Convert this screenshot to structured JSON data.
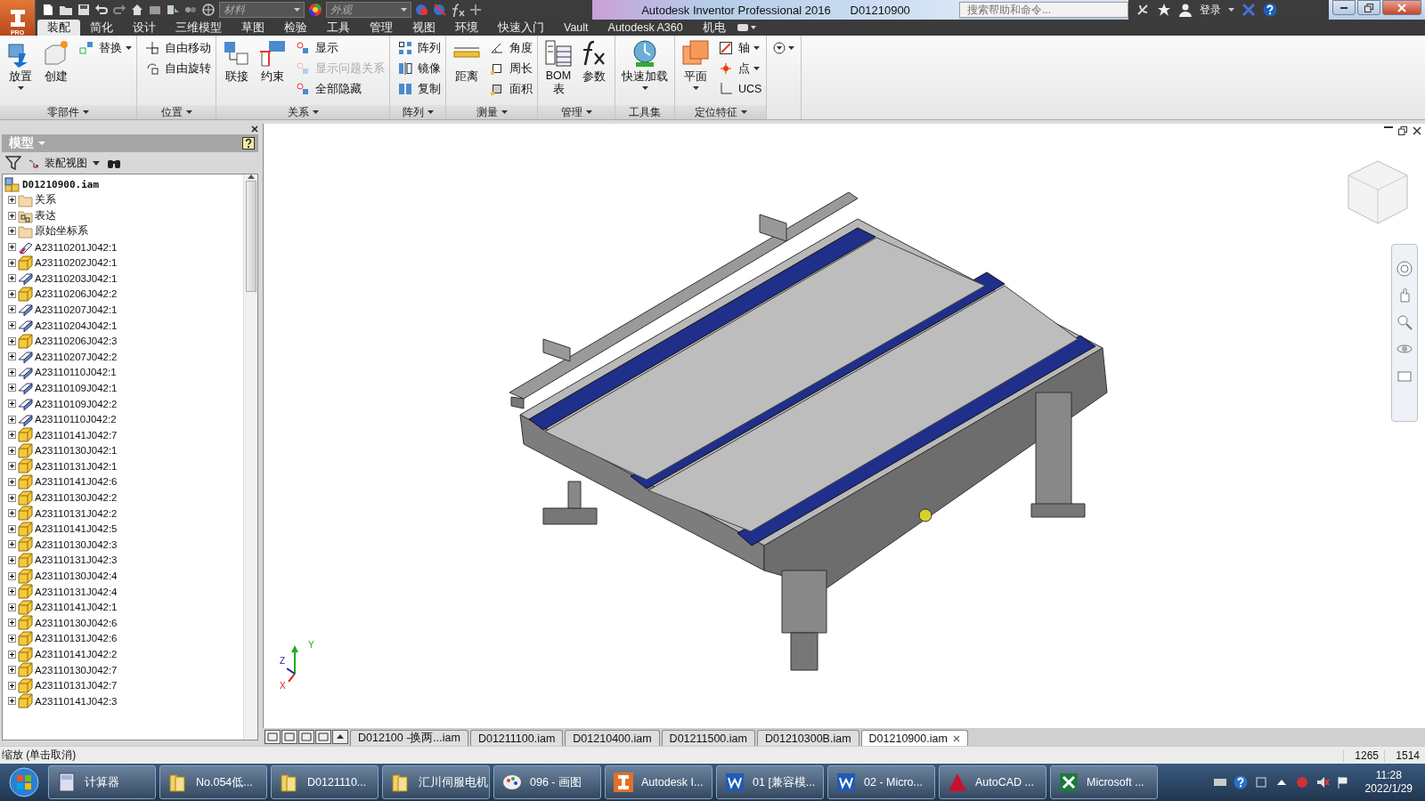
{
  "window": {
    "title": "Autodesk Inventor Professional 2016",
    "document": "D01210900"
  },
  "quick_access": {
    "material": "材料",
    "appearance": "外观"
  },
  "help_search": {
    "placeholder": "搜索帮助和命令..."
  },
  "sign_in": "登录",
  "app_badge": "PRO",
  "ribbon_tabs": [
    {
      "label": "装配",
      "selected": true
    },
    {
      "label": "简化",
      "selected": false
    },
    {
      "label": "设计",
      "selected": false
    },
    {
      "label": "三维模型",
      "selected": false
    },
    {
      "label": "草图",
      "selected": false
    },
    {
      "label": "检验",
      "selected": false
    },
    {
      "label": "工具",
      "selected": false
    },
    {
      "label": "管理",
      "selected": false
    },
    {
      "label": "视图",
      "selected": false
    },
    {
      "label": "环境",
      "selected": false
    },
    {
      "label": "快速入门",
      "selected": false
    },
    {
      "label": "Vault",
      "selected": false
    },
    {
      "label": "Autodesk A360",
      "selected": false
    },
    {
      "label": "机电",
      "selected": false
    }
  ],
  "ribbon_panels": [
    {
      "label": "零部件",
      "large": [
        {
          "label": "放置",
          "dropdown": true
        },
        {
          "label": "创建",
          "dropdown": false
        }
      ],
      "small": [
        {
          "label": "替换",
          "disabled": false,
          "dropdown": true
        }
      ]
    },
    {
      "label": "位置",
      "small": [
        {
          "label": "自由移动",
          "disabled": false,
          "dropdown": false
        },
        {
          "label": "自由旋转",
          "disabled": false,
          "dropdown": false
        }
      ]
    },
    {
      "label": "关系",
      "large": [
        {
          "label": "联接",
          "dropdown": false
        },
        {
          "label": "约束",
          "dropdown": false
        }
      ],
      "small": [
        {
          "label": "显示",
          "disabled": false,
          "dropdown": false
        },
        {
          "label": "显示问题关系",
          "disabled": true,
          "dropdown": false
        },
        {
          "label": "全部隐藏",
          "disabled": false,
          "dropdown": false
        }
      ]
    },
    {
      "label": "阵列",
      "small": [
        {
          "label": "阵列",
          "disabled": false,
          "dropdown": false
        },
        {
          "label": "镜像",
          "disabled": false,
          "dropdown": false
        },
        {
          "label": "复制",
          "disabled": false,
          "dropdown": false
        }
      ]
    },
    {
      "label": "测量",
      "large": [
        {
          "label": "距离",
          "dropdown": false
        }
      ],
      "small": [
        {
          "label": "角度",
          "disabled": false,
          "dropdown": false
        },
        {
          "label": "周长",
          "disabled": false,
          "dropdown": false
        },
        {
          "label": "面积",
          "disabled": false,
          "dropdown": false
        }
      ]
    },
    {
      "label": "管理",
      "large": [
        {
          "label": "BOM 表",
          "dropdown": false
        },
        {
          "label": "参数",
          "dropdown": false
        }
      ]
    },
    {
      "label": "工具集",
      "large": [
        {
          "label": "快速加载",
          "dropdown": true
        }
      ]
    },
    {
      "label": "定位特征",
      "large": [
        {
          "label": "平面",
          "dropdown": true
        }
      ],
      "small": [
        {
          "label": "轴",
          "disabled": false,
          "dropdown": true
        },
        {
          "label": "点",
          "disabled": false,
          "dropdown": true
        },
        {
          "label": "UCS",
          "disabled": false,
          "dropdown": false
        }
      ]
    }
  ],
  "browser": {
    "title": "模型",
    "view": "装配视图",
    "root": "D01210900.iam",
    "items": [
      {
        "kind": "folder",
        "label": "关系"
      },
      {
        "kind": "views",
        "label": "表达"
      },
      {
        "kind": "folder",
        "label": "原始坐标系"
      },
      {
        "kind": "weld",
        "label": "A23110201J042:1"
      },
      {
        "kind": "part",
        "label": "A23110202J042:1"
      },
      {
        "kind": "sheet",
        "label": "A23110203J042:1"
      },
      {
        "kind": "part",
        "label": "A23110206J042:2"
      },
      {
        "kind": "sheet",
        "label": "A23110207J042:1"
      },
      {
        "kind": "sheet",
        "label": "A23110204J042:1"
      },
      {
        "kind": "part",
        "label": "A23110206J042:3"
      },
      {
        "kind": "sheet",
        "label": "A23110207J042:2"
      },
      {
        "kind": "sheet",
        "label": "A23110110J042:1"
      },
      {
        "kind": "sheet",
        "label": "A23110109J042:1"
      },
      {
        "kind": "sheet",
        "label": "A23110109J042:2"
      },
      {
        "kind": "sheet",
        "label": "A23110110J042:2"
      },
      {
        "kind": "part",
        "label": "A23110141J042:7"
      },
      {
        "kind": "part",
        "label": "A23110130J042:1"
      },
      {
        "kind": "part",
        "label": "A23110131J042:1"
      },
      {
        "kind": "part",
        "label": "A23110141J042:6"
      },
      {
        "kind": "part",
        "label": "A23110130J042:2"
      },
      {
        "kind": "part",
        "label": "A23110131J042:2"
      },
      {
        "kind": "part",
        "label": "A23110141J042:5"
      },
      {
        "kind": "part",
        "label": "A23110130J042:3"
      },
      {
        "kind": "part",
        "label": "A23110131J042:3"
      },
      {
        "kind": "part",
        "label": "A23110130J042:4"
      },
      {
        "kind": "part",
        "label": "A23110131J042:4"
      },
      {
        "kind": "part",
        "label": "A23110141J042:1"
      },
      {
        "kind": "part",
        "label": "A23110130J042:6"
      },
      {
        "kind": "part",
        "label": "A23110131J042:6"
      },
      {
        "kind": "part",
        "label": "A23110141J042:2"
      },
      {
        "kind": "part",
        "label": "A23110130J042:7"
      },
      {
        "kind": "part",
        "label": "A23110131J042:7"
      },
      {
        "kind": "part",
        "label": "A23110141J042:3"
      }
    ]
  },
  "axis_triad": {
    "y": "Y",
    "z": "Z",
    "x": "X"
  },
  "document_tabs": [
    {
      "label": "D012100 -换两...iam",
      "selected": false
    },
    {
      "label": "D01211100.iam",
      "selected": false
    },
    {
      "label": "D01210400.iam",
      "selected": false
    },
    {
      "label": "D01211500.iam",
      "selected": false
    },
    {
      "label": "D01210300B.iam",
      "selected": false
    },
    {
      "label": "D01210900.iam",
      "selected": true
    }
  ],
  "status_bar": {
    "message": "缩放 (单击取消)",
    "values": [
      "1265",
      "1514"
    ]
  },
  "taskbar": {
    "items": [
      {
        "kind": "calc",
        "label": "计算器"
      },
      {
        "kind": "folder",
        "label": "No.054低..."
      },
      {
        "kind": "folder",
        "label": "D0121110..."
      },
      {
        "kind": "folder",
        "label": "汇川伺服电机"
      },
      {
        "kind": "paint",
        "label": "096 - 画图"
      },
      {
        "kind": "inventor",
        "label": "Autodesk I..."
      },
      {
        "kind": "word",
        "label": "01 [兼容模..."
      },
      {
        "kind": "word",
        "label": "02 - Micro..."
      },
      {
        "kind": "autocad",
        "label": "AutoCAD ..."
      },
      {
        "kind": "excel",
        "label": "Microsoft ..."
      }
    ],
    "time": "11:28",
    "date": "2022/1/29"
  }
}
